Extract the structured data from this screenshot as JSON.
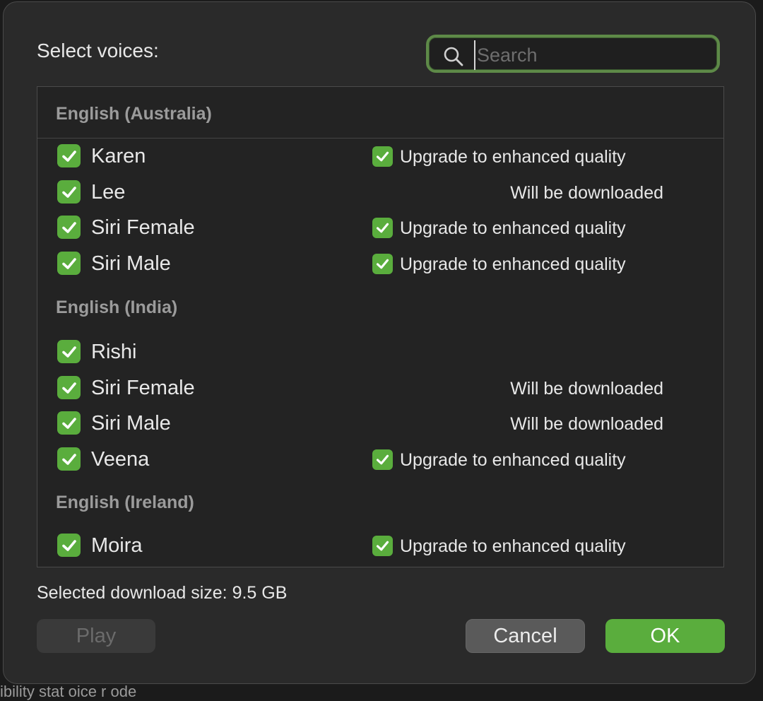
{
  "backdrop_text": "ibility  stat  oice  r  ode",
  "dialog": {
    "title": "Select voices:",
    "search": {
      "placeholder": "Search",
      "value": ""
    },
    "groups": [
      {
        "name": "English (Australia)",
        "voices": [
          {
            "name": "Karen",
            "status": "Upgrade to enhanced quality",
            "status_type": "upgrade"
          },
          {
            "name": "Lee",
            "status": "Will be downloaded",
            "status_type": "download"
          },
          {
            "name": "Siri Female",
            "status": "Upgrade to enhanced quality",
            "status_type": "upgrade"
          },
          {
            "name": "Siri Male",
            "status": "Upgrade to enhanced quality",
            "status_type": "upgrade"
          }
        ]
      },
      {
        "name": "English (India)",
        "voices": [
          {
            "name": "Rishi",
            "status": "",
            "status_type": "none"
          },
          {
            "name": "Siri Female",
            "status": "Will be downloaded",
            "status_type": "download"
          },
          {
            "name": "Siri Male",
            "status": "Will be downloaded",
            "status_type": "download"
          },
          {
            "name": "Veena",
            "status": "Upgrade to enhanced quality",
            "status_type": "upgrade"
          }
        ]
      },
      {
        "name": "English (Ireland)",
        "voices": [
          {
            "name": "Moira",
            "status": "Upgrade to enhanced quality",
            "status_type": "upgrade"
          }
        ]
      }
    ],
    "download_size_label": "Selected download size: 9.5 GB",
    "buttons": {
      "play": "Play",
      "cancel": "Cancel",
      "ok": "OK"
    }
  },
  "colors": {
    "accent_green": "#5aad3d",
    "focus_ring": "#5e8a48"
  },
  "icons": {
    "search": "magnifier-icon",
    "checkbox": "checkmark-icon"
  }
}
